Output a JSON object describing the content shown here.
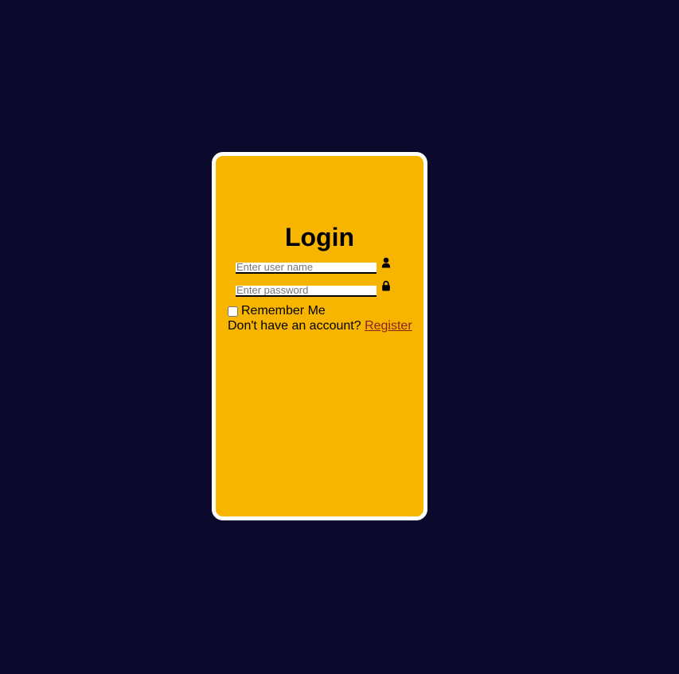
{
  "colors": {
    "background": "#0b0a2d",
    "card": "#f8b500",
    "card_border": "#ffffff",
    "link": "#8b1f1f"
  },
  "login": {
    "title": "Login",
    "username": {
      "placeholder": "Enter user name",
      "value": "",
      "icon": "user-icon"
    },
    "password": {
      "placeholder": "Enter password",
      "value": "",
      "icon": "lock-icon"
    },
    "remember_label": "Remember Me",
    "remember_checked": false,
    "signup_prompt": "Don't have an account?",
    "register_link": "Register"
  }
}
